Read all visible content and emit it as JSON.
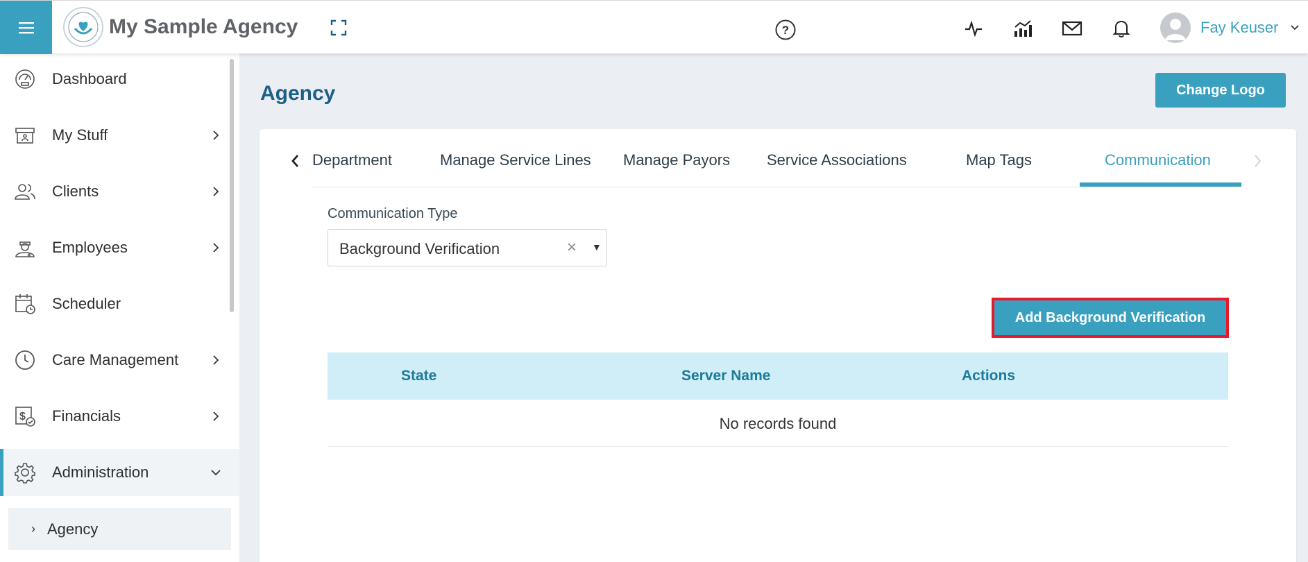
{
  "header": {
    "brand": "My Sample Agency",
    "user_name": "Fay Keuser",
    "icons": [
      "menu-icon",
      "expand-icon",
      "help-icon",
      "activity-icon",
      "analytics-icon",
      "mail-icon",
      "bell-icon",
      "user-avatar",
      "chevron-down-icon"
    ]
  },
  "sidebar": {
    "items": [
      {
        "label": "Dashboard",
        "icon": "dashboard-icon"
      },
      {
        "label": "My Stuff",
        "icon": "archive-icon"
      },
      {
        "label": "Clients",
        "icon": "users-icon"
      },
      {
        "label": "Employees",
        "icon": "employee-icon"
      },
      {
        "label": "Scheduler",
        "icon": "calendar-icon"
      },
      {
        "label": "Care Management",
        "icon": "clock-icon"
      },
      {
        "label": "Financials",
        "icon": "financials-icon"
      },
      {
        "label": "Administration",
        "icon": "gear-icon"
      }
    ],
    "sub_item": "Agency"
  },
  "page": {
    "title": "Agency",
    "change_logo": "Change Logo"
  },
  "tabs": [
    {
      "label": "Department"
    },
    {
      "label": "Manage Service Lines"
    },
    {
      "label": "Manage Payors"
    },
    {
      "label": "Service Associations"
    },
    {
      "label": "Map Tags"
    },
    {
      "label": "Communication",
      "active": true
    }
  ],
  "form": {
    "label": "Communication Type",
    "selected": "Background Verification",
    "clear_glyph": "×",
    "arrow_glyph": "▼"
  },
  "add_button": "Add Background Verification",
  "table": {
    "columns": [
      "State",
      "Server Name",
      "Actions"
    ],
    "empty": "No records found"
  },
  "colors": {
    "accent": "#3aa0c0",
    "title": "#1e5f86",
    "highlight_border": "#e8192c",
    "table_header": "#cfeef7"
  }
}
